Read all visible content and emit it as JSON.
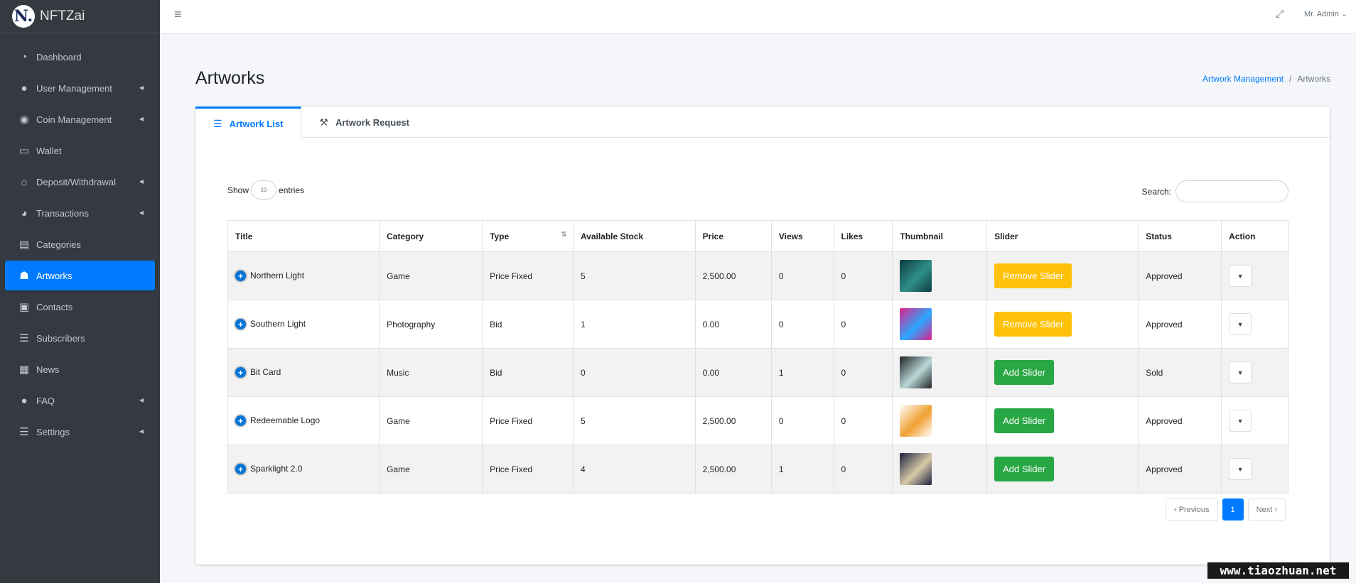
{
  "brand": {
    "logo_letter": "N.",
    "name": "NFTZai"
  },
  "sidebar": {
    "items": [
      {
        "label": "Dashboard",
        "icon": "gauge-icon",
        "glyph": "◔",
        "has_arrow": false,
        "active": false
      },
      {
        "label": "User Management",
        "icon": "user-icon",
        "glyph": "●",
        "has_arrow": true,
        "active": false
      },
      {
        "label": "Coin Management",
        "icon": "coins-icon",
        "glyph": "◉",
        "has_arrow": true,
        "active": false
      },
      {
        "label": "Wallet",
        "icon": "wallet-icon",
        "glyph": "▭",
        "has_arrow": false,
        "active": false
      },
      {
        "label": "Deposit/Withdrawal",
        "icon": "bank-icon",
        "glyph": "⌂",
        "has_arrow": true,
        "active": false
      },
      {
        "label": "Transactions",
        "icon": "pie-chart-icon",
        "glyph": "◕",
        "has_arrow": true,
        "active": false
      },
      {
        "label": "Categories",
        "icon": "list-alt-icon",
        "glyph": "▤",
        "has_arrow": false,
        "active": false
      },
      {
        "label": "Artworks",
        "icon": "hand-user-icon",
        "glyph": "☗",
        "has_arrow": false,
        "active": true
      },
      {
        "label": "Contacts",
        "icon": "address-book-icon",
        "glyph": "▣",
        "has_arrow": false,
        "active": false
      },
      {
        "label": "Subscribers",
        "icon": "list-icon",
        "glyph": "☰",
        "has_arrow": false,
        "active": false
      },
      {
        "label": "News",
        "icon": "newspaper-icon",
        "glyph": "▦",
        "has_arrow": false,
        "active": false
      },
      {
        "label": "FAQ",
        "icon": "user-secret-icon",
        "glyph": "●",
        "has_arrow": true,
        "active": false
      },
      {
        "label": "Settings",
        "icon": "list-icon",
        "glyph": "☰",
        "has_arrow": true,
        "active": false
      }
    ]
  },
  "topbar": {
    "user_label": "Mr. Admin"
  },
  "page": {
    "title": "Artworks"
  },
  "breadcrumb": {
    "parent": "Artwork Management",
    "current": "Artworks"
  },
  "tabs": [
    {
      "label": "Artwork List",
      "active": true
    },
    {
      "label": "Artwork Request",
      "active": false
    }
  ],
  "table_controls": {
    "show_label": "Show",
    "entries_value": "10",
    "entries_label": "entries",
    "search_label": "Search:"
  },
  "table": {
    "columns": [
      "Title",
      "Category",
      "Type",
      "Available Stock",
      "Price",
      "Views",
      "Likes",
      "Thumbnail",
      "Slider",
      "Status",
      "Action"
    ],
    "rows": [
      {
        "title": "Northern Light",
        "category": "Game",
        "type": "Price Fixed",
        "stock": "5",
        "price": "2,500.00",
        "views": "0",
        "likes": "0",
        "slider": "Remove Slider",
        "slider_kind": "warning",
        "status": "Approved",
        "thumb_colors": [
          "#0c3b3e",
          "#2f8f8a"
        ]
      },
      {
        "title": "Southern Light",
        "category": "Photography",
        "type": "Bid",
        "stock": "1",
        "price": "0.00",
        "views": "0",
        "likes": "0",
        "slider": "Remove Slider",
        "slider_kind": "warning",
        "status": "Approved",
        "thumb_colors": [
          "#e0208a",
          "#2aa8ff"
        ]
      },
      {
        "title": "Bit Card",
        "category": "Music",
        "type": "Bid",
        "stock": "0",
        "price": "0.00",
        "views": "1",
        "likes": "0",
        "slider": "Add Slider",
        "slider_kind": "success",
        "status": "Sold",
        "thumb_colors": [
          "#1e2326",
          "#b9d8d6"
        ]
      },
      {
        "title": "Redeemable Logo",
        "category": "Game",
        "type": "Price Fixed",
        "stock": "5",
        "price": "2,500.00",
        "views": "0",
        "likes": "0",
        "slider": "Add Slider",
        "slider_kind": "success",
        "status": "Approved",
        "thumb_colors": [
          "#ffffff",
          "#f0a030"
        ]
      },
      {
        "title": "Sparklight 2.0",
        "category": "Game",
        "type": "Price Fixed",
        "stock": "4",
        "price": "2,500.00",
        "views": "1",
        "likes": "0",
        "slider": "Add Slider",
        "slider_kind": "success",
        "status": "Approved",
        "thumb_colors": [
          "#1b2240",
          "#d8c9a8"
        ]
      }
    ]
  },
  "pagination": {
    "previous": "‹ Previous",
    "current": "1",
    "next": "Next ›"
  },
  "watermark": "www.tiaozhuan.net",
  "colors": {
    "primary": "#007bff",
    "sidebar_bg": "#343a40",
    "warning": "#ffc107",
    "success": "#28a745"
  }
}
